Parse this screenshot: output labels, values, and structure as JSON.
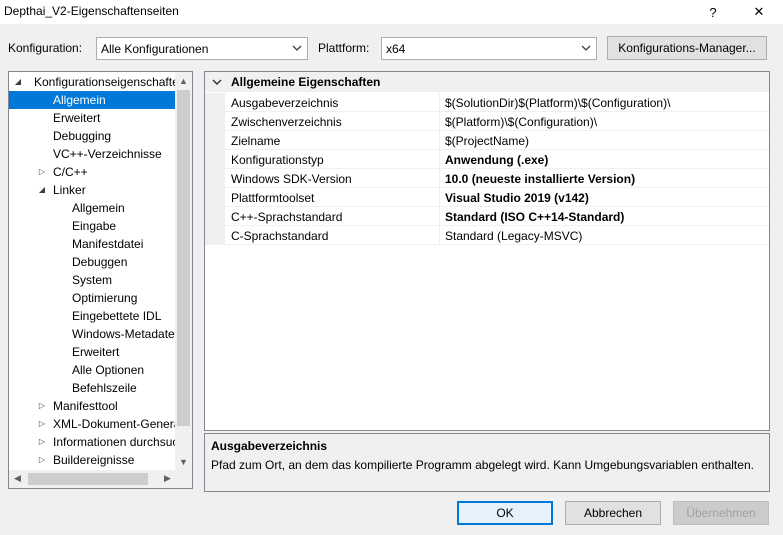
{
  "window": {
    "title": "Depthai_V2-Eigenschaftenseiten",
    "help_glyph": "?",
    "close_glyph": "✕"
  },
  "toolbar": {
    "config_label": "Konfiguration:",
    "config_value": "Alle Konfigurationen",
    "platform_label": "Plattform:",
    "platform_value": "x64",
    "config_manager_button": "Konfigurations-Manager..."
  },
  "tree": {
    "items": [
      {
        "label": "Konfigurationseigenschaften",
        "level": 0,
        "expander": "expanded"
      },
      {
        "label": "Allgemein",
        "level": 1,
        "expander": "none",
        "selected": true
      },
      {
        "label": "Erweitert",
        "level": 1,
        "expander": "none"
      },
      {
        "label": "Debugging",
        "level": 1,
        "expander": "none"
      },
      {
        "label": "VC++-Verzeichnisse",
        "level": 1,
        "expander": "none"
      },
      {
        "label": "C/C++",
        "level": 1,
        "expander": "collapsed"
      },
      {
        "label": "Linker",
        "level": 1,
        "expander": "expanded"
      },
      {
        "label": "Allgemein",
        "level": 2,
        "expander": "none"
      },
      {
        "label": "Eingabe",
        "level": 2,
        "expander": "none"
      },
      {
        "label": "Manifestdatei",
        "level": 2,
        "expander": "none"
      },
      {
        "label": "Debuggen",
        "level": 2,
        "expander": "none"
      },
      {
        "label": "System",
        "level": 2,
        "expander": "none"
      },
      {
        "label": "Optimierung",
        "level": 2,
        "expander": "none"
      },
      {
        "label": "Eingebettete IDL",
        "level": 2,
        "expander": "none"
      },
      {
        "label": "Windows-Metadaten",
        "level": 2,
        "expander": "none"
      },
      {
        "label": "Erweitert",
        "level": 2,
        "expander": "none"
      },
      {
        "label": "Alle Optionen",
        "level": 2,
        "expander": "none"
      },
      {
        "label": "Befehlszeile",
        "level": 2,
        "expander": "none"
      },
      {
        "label": "Manifesttool",
        "level": 1,
        "expander": "collapsed"
      },
      {
        "label": "XML-Dokument-Generator",
        "level": 1,
        "expander": "collapsed"
      },
      {
        "label": "Informationen durchsuchen",
        "level": 1,
        "expander": "collapsed"
      },
      {
        "label": "Buildereignisse",
        "level": 1,
        "expander": "collapsed"
      }
    ]
  },
  "grid": {
    "category": "Allgemeine Eigenschaften",
    "rows": [
      {
        "name": "Ausgabeverzeichnis",
        "value": "$(SolutionDir)$(Platform)\\$(Configuration)\\",
        "bold": false
      },
      {
        "name": "Zwischenverzeichnis",
        "value": "$(Platform)\\$(Configuration)\\",
        "bold": false
      },
      {
        "name": "Zielname",
        "value": "$(ProjectName)",
        "bold": false
      },
      {
        "name": "Konfigurationstyp",
        "value": "Anwendung (.exe)",
        "bold": true
      },
      {
        "name": "Windows SDK-Version",
        "value": "10.0 (neueste installierte Version)",
        "bold": true
      },
      {
        "name": "Plattformtoolset",
        "value": "Visual Studio 2019 (v142)",
        "bold": true
      },
      {
        "name": "C++-Sprachstandard",
        "value": "Standard (ISO C++14-Standard)",
        "bold": true
      },
      {
        "name": "C-Sprachstandard",
        "value": "Standard (Legacy-MSVC)",
        "bold": false
      }
    ]
  },
  "description": {
    "title": "Ausgabeverzeichnis",
    "text": "Pfad zum Ort, an dem das kompilierte Programm abgelegt wird. Kann Umgebungsvariablen enthalten."
  },
  "buttons": {
    "ok": "OK",
    "cancel": "Abbrechen",
    "apply": "Übernehmen"
  },
  "colors": {
    "selection": "#0078d7",
    "window_bg": "#f0f0f0",
    "border": "#828790"
  }
}
